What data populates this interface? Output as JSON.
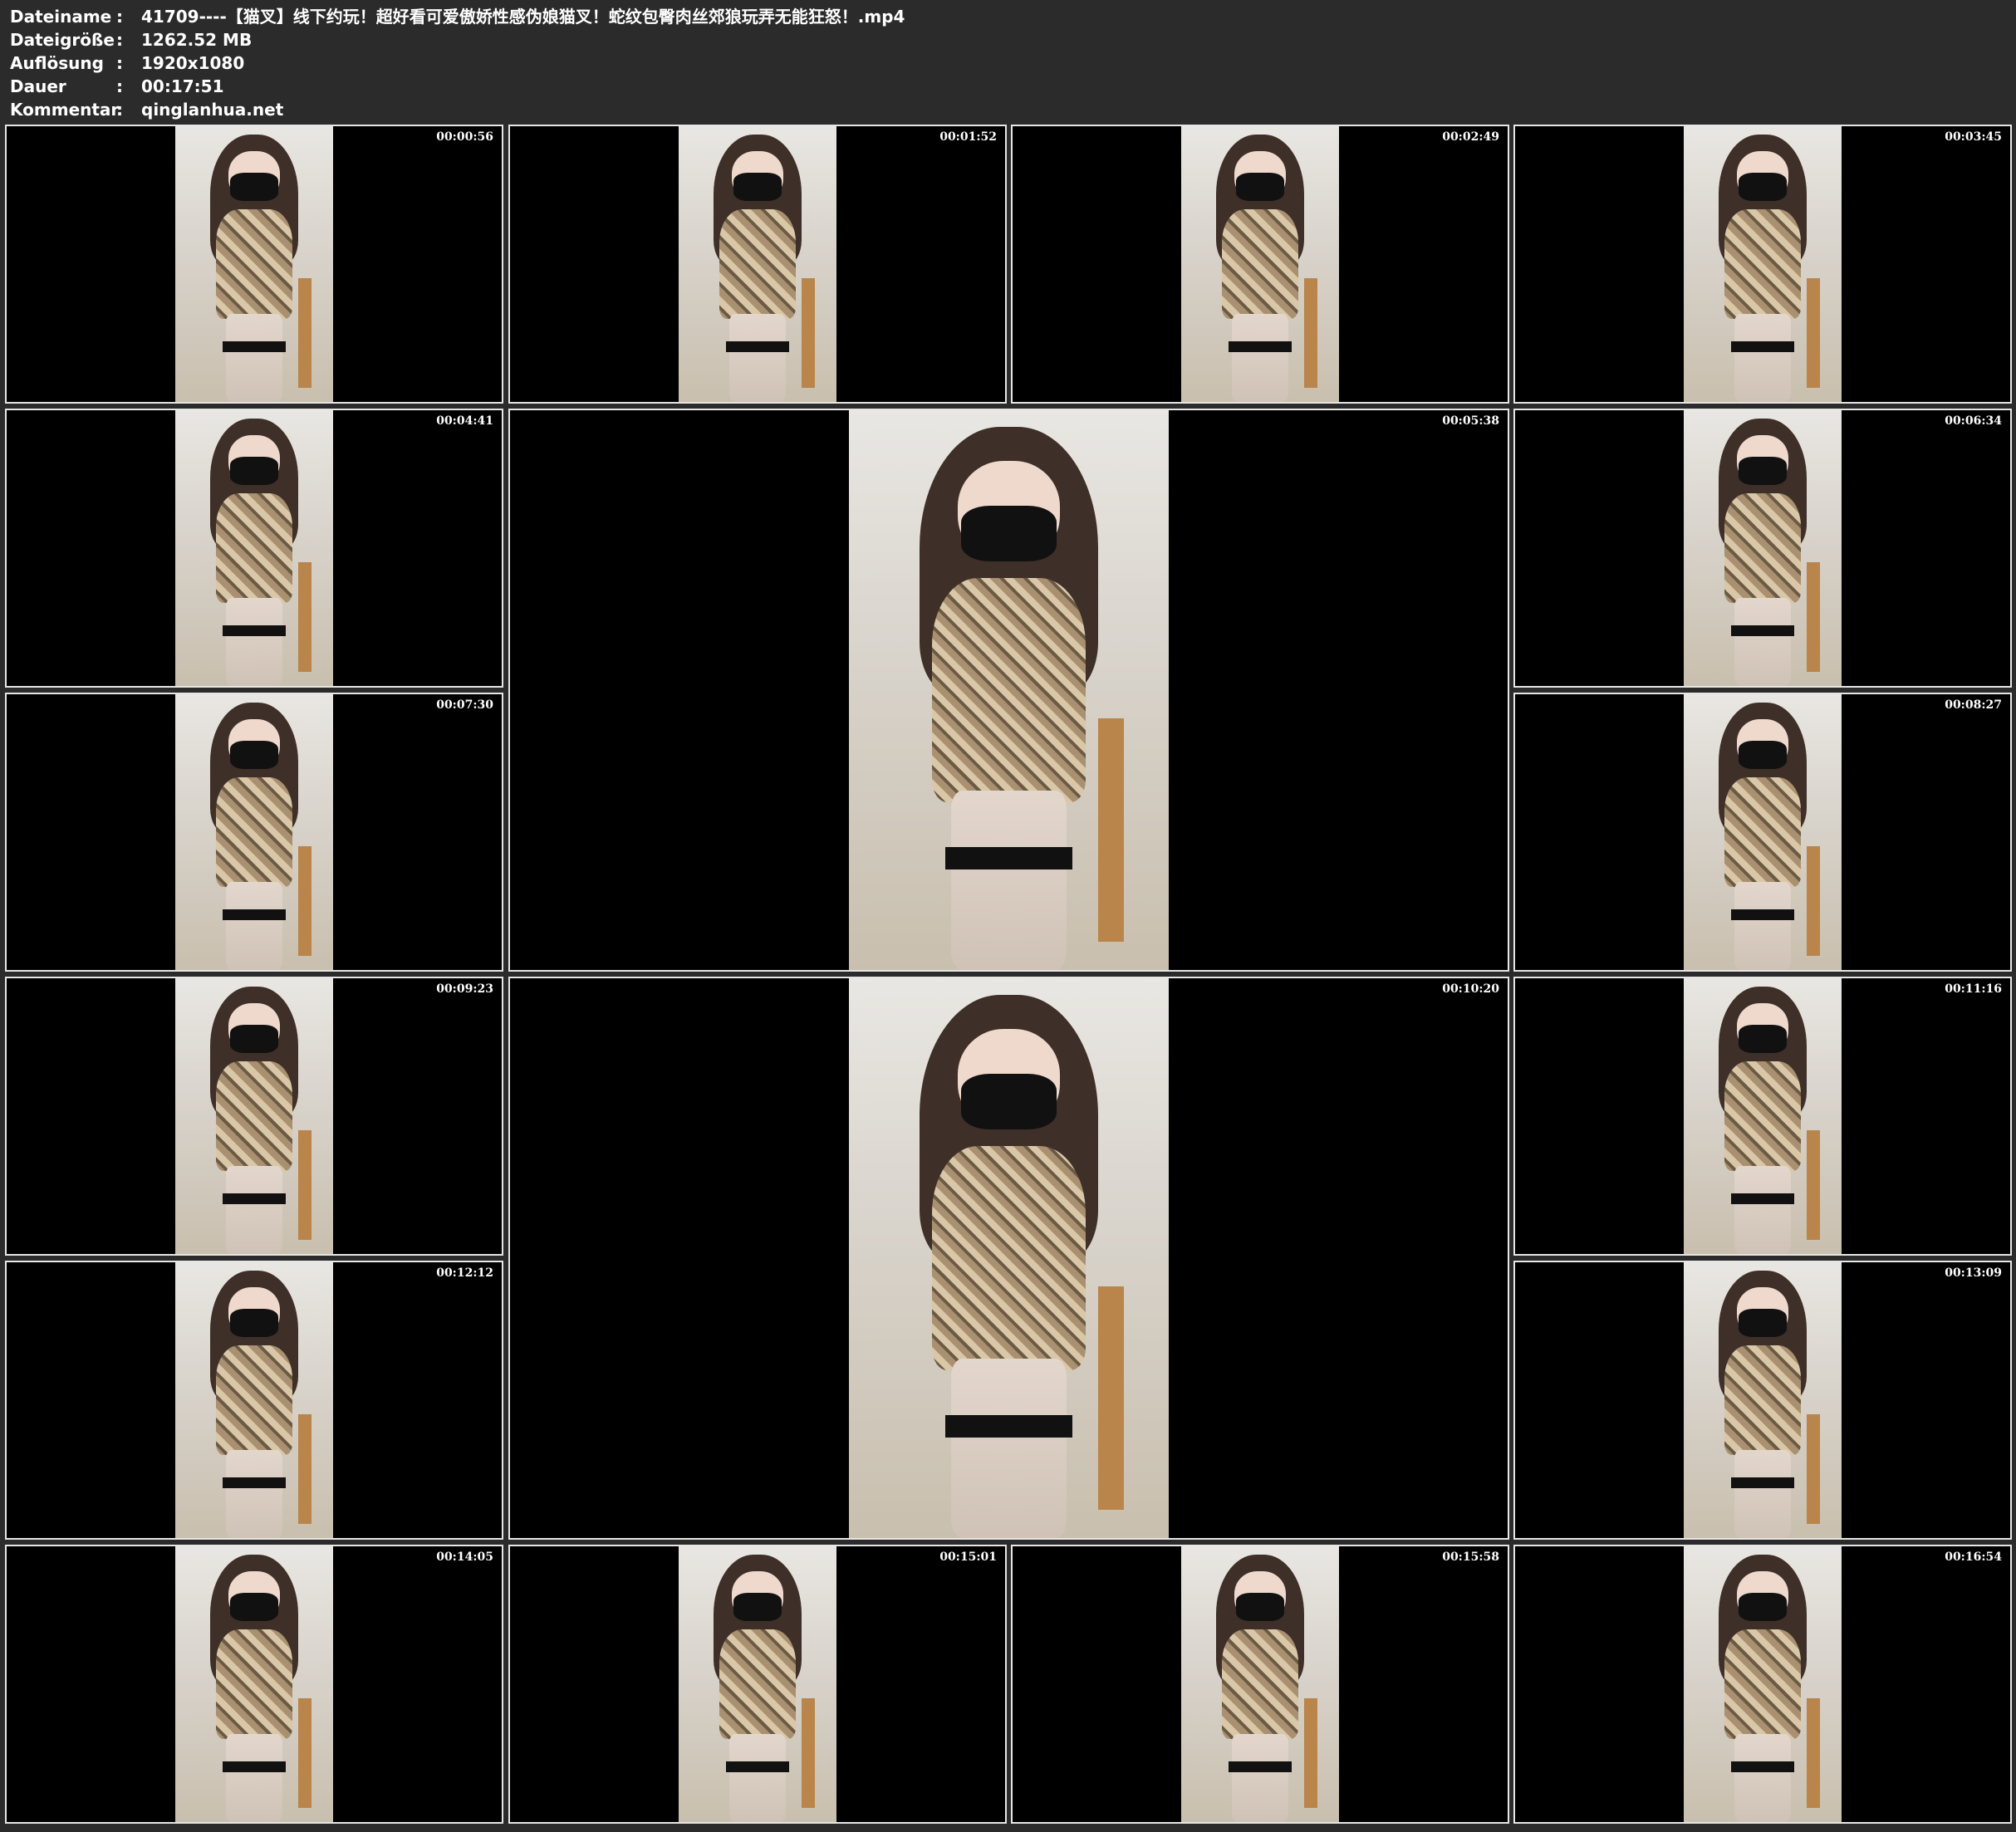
{
  "header": {
    "rows": [
      {
        "key": "Dateiname",
        "sep": ":",
        "value": "41709----【猫叉】线下约玩！超好看可爱傲娇性感伪娘猫叉！蛇纹包臀肉丝郊狼玩弄无能狂怒！.mp4"
      },
      {
        "key": "Dateigröße",
        "sep": ":",
        "value": "1262.52 MB"
      },
      {
        "key": "Auflösung",
        "sep": ":",
        "value": "1920x1080"
      },
      {
        "key": "Dauer",
        "sep": ":",
        "value": "00:17:51"
      },
      {
        "key": "Kommentar",
        "sep": ":",
        "value": "qinglanhua.net"
      }
    ]
  },
  "thumbnails": [
    {
      "timestamp": "00:00:56"
    },
    {
      "timestamp": "00:01:52"
    },
    {
      "timestamp": "00:02:49"
    },
    {
      "timestamp": "00:03:45"
    },
    {
      "timestamp": "00:04:41"
    },
    {
      "timestamp": "00:05:38"
    },
    {
      "timestamp": "00:06:34"
    },
    {
      "timestamp": "00:07:30"
    },
    {
      "timestamp": "00:08:27"
    },
    {
      "timestamp": "00:09:23"
    },
    {
      "timestamp": "00:10:20"
    },
    {
      "timestamp": "00:11:16"
    },
    {
      "timestamp": "00:12:12"
    },
    {
      "timestamp": "00:13:09"
    },
    {
      "timestamp": "00:14:05"
    },
    {
      "timestamp": "00:15:01"
    },
    {
      "timestamp": "00:15:58"
    },
    {
      "timestamp": "00:16:54"
    }
  ]
}
